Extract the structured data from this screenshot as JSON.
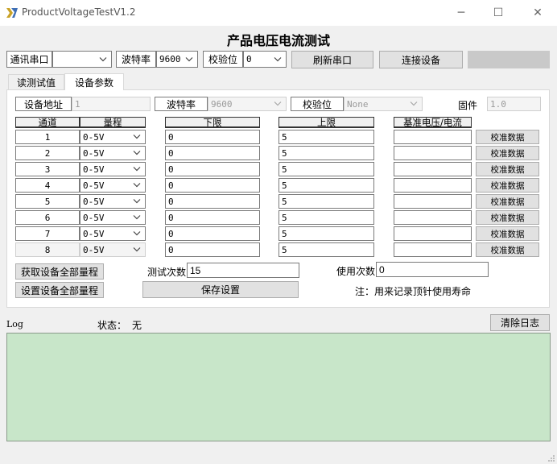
{
  "window": {
    "title": "ProductVoltageTestV1.2",
    "minimize_glyph": "─",
    "maximize_glyph": "☐",
    "close_glyph": "✕"
  },
  "heading": "产品电压电流测试",
  "toolbar": {
    "port_label": "通讯串口",
    "port_value": "",
    "baud_label": "波特率",
    "baud_value": "9600",
    "parity_label": "校验位",
    "parity_value": "0",
    "refresh_button": "刷新串口",
    "connect_button": "连接设备",
    "status_indicator": ""
  },
  "tabs": [
    {
      "label": "读测试值",
      "active": false
    },
    {
      "label": "设备参数",
      "active": true
    }
  ],
  "device_params": {
    "address_label": "设备地址",
    "address_value": "1",
    "baud_label": "波特率",
    "baud_value": "9600",
    "parity_label": "校验位",
    "parity_value": "None",
    "firmware_label": "固件",
    "firmware_value": "1.0"
  },
  "table": {
    "headers": {
      "channel": "通道",
      "range": "量程",
      "lower": "下限",
      "upper": "上限",
      "reference": "基准电压/电流"
    },
    "calibrate_label": "校准数据",
    "rows": [
      {
        "channel": "1",
        "range": "0-5V",
        "lower": "0",
        "upper": "5",
        "reference": ""
      },
      {
        "channel": "2",
        "range": "0-5V",
        "lower": "0",
        "upper": "5",
        "reference": ""
      },
      {
        "channel": "3",
        "range": "0-5V",
        "lower": "0",
        "upper": "5",
        "reference": ""
      },
      {
        "channel": "4",
        "range": "0-5V",
        "lower": "0",
        "upper": "5",
        "reference": ""
      },
      {
        "channel": "5",
        "range": "0-5V",
        "lower": "0",
        "upper": "5",
        "reference": ""
      },
      {
        "channel": "6",
        "range": "0-5V",
        "lower": "0",
        "upper": "5",
        "reference": ""
      },
      {
        "channel": "7",
        "range": "0-5V",
        "lower": "0",
        "upper": "5",
        "reference": ""
      },
      {
        "channel": "8",
        "range": "0-5V",
        "lower": "0",
        "upper": "5",
        "reference": ""
      }
    ]
  },
  "bottom": {
    "get_all_ranges": "获取设备全部量程",
    "set_all_ranges": "设置设备全部量程",
    "test_count_label": "测试次数",
    "test_count_value": "15",
    "save_settings": "保存设置",
    "use_count_label": "使用次数",
    "use_count_value": "0",
    "note": "注：用来记录顶针使用寿命"
  },
  "log": {
    "label": "Log",
    "status_label": "状态：",
    "status_value": "无",
    "clear_button": "清除日志",
    "content": ""
  },
  "colors": {
    "log_background": "#c8e6c9",
    "app_icon": "#c9a227"
  }
}
